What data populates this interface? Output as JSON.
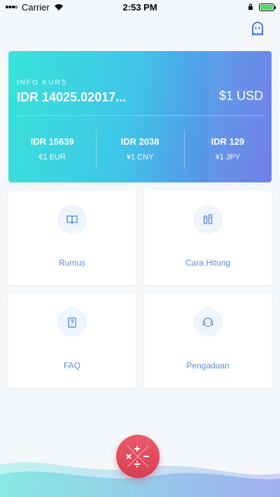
{
  "status_bar": {
    "carrier": "Carrier",
    "time": "2:53 PM"
  },
  "icons": {
    "ghost": "ghost-icon",
    "calculator": "calculator-ops-icon"
  },
  "kurs": {
    "label": "INFO KURS",
    "main_value": "IDR 14025.02017...",
    "base": "$1 USD",
    "rates": [
      {
        "value": "IDR 15639",
        "unit": "€1 EUR"
      },
      {
        "value": "IDR 2038",
        "unit": "¥1 CNY"
      },
      {
        "value": "IDR 129",
        "unit": "¥1 JPY"
      }
    ]
  },
  "menu": {
    "rumus": "Rumus",
    "cara_hitung": "Cara Hitung",
    "faq": "FAQ",
    "pengaduan": "Pengaduan"
  },
  "colors": {
    "accent": "#5a8fd8",
    "fab": "#e0495b",
    "card_start": "#38e3d9",
    "card_end": "#6a78e6"
  }
}
